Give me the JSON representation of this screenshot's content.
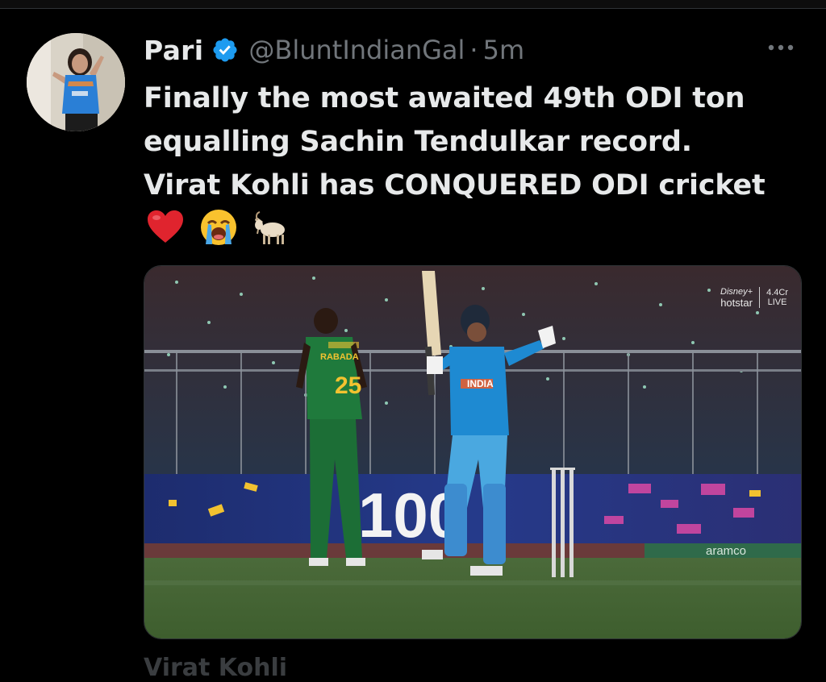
{
  "post": {
    "author": {
      "display_name": "Pari",
      "handle": "@BluntIndianGal",
      "separator": "·",
      "time": "5m",
      "verified": true
    },
    "text_lines": [
      "Finally the most awaited 49th ODI ton",
      "equalling Sachin Tendulkar record.",
      "Virat Kohli has CONQUERED ODI cricket"
    ],
    "emojis": [
      "red-heart",
      "loudly-crying-face",
      "goat"
    ],
    "media": {
      "watermark": {
        "brand_top": "Disney+",
        "brand_bottom": "hotstar",
        "views": "4.4Cr",
        "status": "LIVE"
      },
      "player_left_name": "RABADA",
      "player_left_number": "25",
      "player_right_chest": "INDIA",
      "boundary_board_text": "100",
      "sponsor_text": "aramco"
    }
  },
  "next_post_preview": "Virat Kohli",
  "colors": {
    "background": "#000000",
    "text_primary": "#e7e9ea",
    "text_secondary": "#71767b",
    "verified_blue": "#1d9bf0",
    "divider": "#2f3336"
  },
  "icons": {
    "verified": "verified-badge-icon",
    "more": "more-horizontal-icon"
  }
}
